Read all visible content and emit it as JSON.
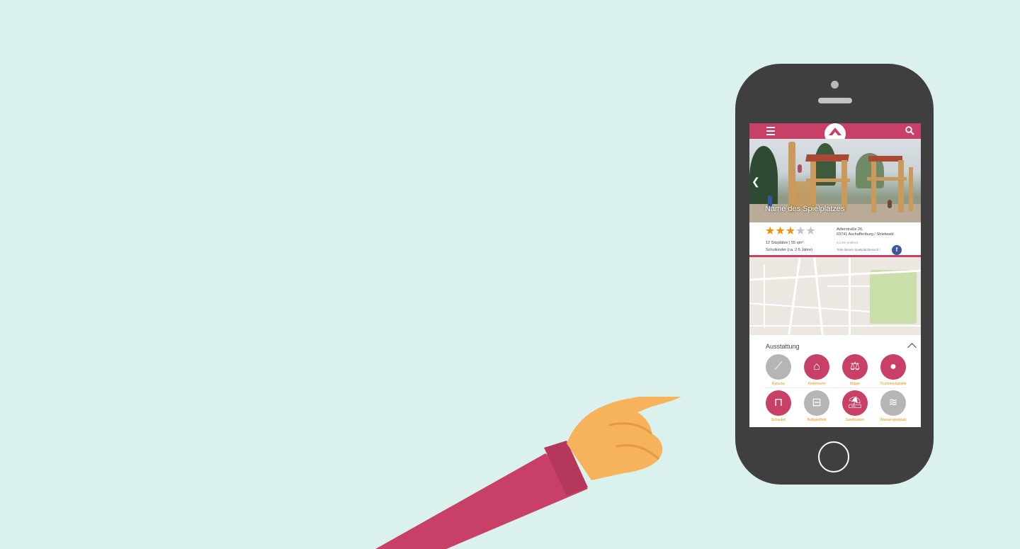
{
  "app": {
    "colors": {
      "brand": "#c83f67",
      "accent": "#f39200",
      "inactive": "#b5b5b5",
      "background": "#daf1ee"
    },
    "header": {
      "menu_icon": "hamburger-icon",
      "logo": "house-roof-logo",
      "search_icon": "search-icon"
    }
  },
  "playground": {
    "title": "Name des Spielplatzes",
    "rating": 3,
    "rating_max": 5,
    "capacity": "12 Sitzplätze | 55 qm²",
    "age_group": "Schulkinder (ca. 2-5 Jahre)",
    "address_line1": "Adlerstraße 26,",
    "address_line2": "63741 Aschaffenburg / Strietwald",
    "distance": "0,2 km entfernt",
    "share_text": "Teile deinen Spielplatzbesuch !",
    "share_icon": "facebook-icon"
  },
  "equipment": {
    "title": "Ausstattung",
    "collapse_icon": "chevron-up-icon",
    "items": [
      {
        "label": "Rutsche",
        "icon": "slide-icon",
        "available": false
      },
      {
        "label": "Kletterturm",
        "icon": "climbing-tower-icon",
        "available": true
      },
      {
        "label": "Wippe",
        "icon": "seesaw-icon",
        "available": true
      },
      {
        "label": "Tischtennisplatte",
        "icon": "table-tennis-icon",
        "available": true
      },
      {
        "label": "Schaukel",
        "icon": "swing-icon",
        "available": true
      },
      {
        "label": "Ballspielfeld",
        "icon": "ball-field-icon",
        "available": false
      },
      {
        "label": "Sandkasten",
        "icon": "sandbox-icon",
        "available": true
      },
      {
        "label": "Wasserspielplatz",
        "icon": "water-playground-icon",
        "available": false
      }
    ]
  }
}
